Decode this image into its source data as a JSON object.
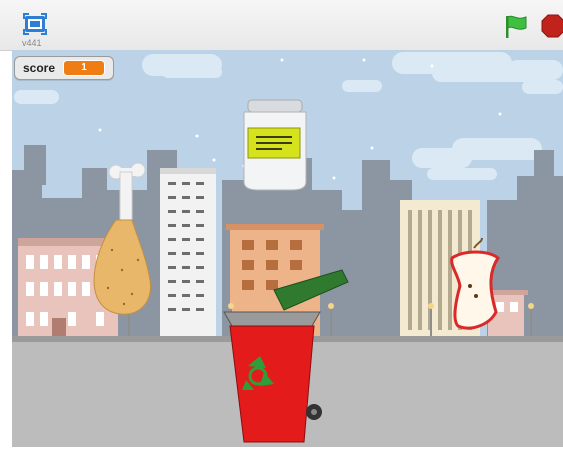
{
  "topbar": {
    "version": "v441",
    "fullscreen_icon": "fullscreen-icon",
    "flag_icon": "green-flag-icon",
    "stop_icon": "stop-sign-icon",
    "flag_color": "#3fbf3f",
    "stop_color": "#c0221c"
  },
  "monitor": {
    "label": "score",
    "value": "1",
    "value_color": "#ef7d14"
  },
  "stage": {
    "sky_color": "#bcd2e6",
    "ground_color": "#bcbcbc",
    "sprites": [
      "chicken-leg",
      "glass-jar",
      "apple-core",
      "recycle-bin"
    ],
    "bin_color": "#e41b1b",
    "lid_color": "#2f7a2f"
  }
}
